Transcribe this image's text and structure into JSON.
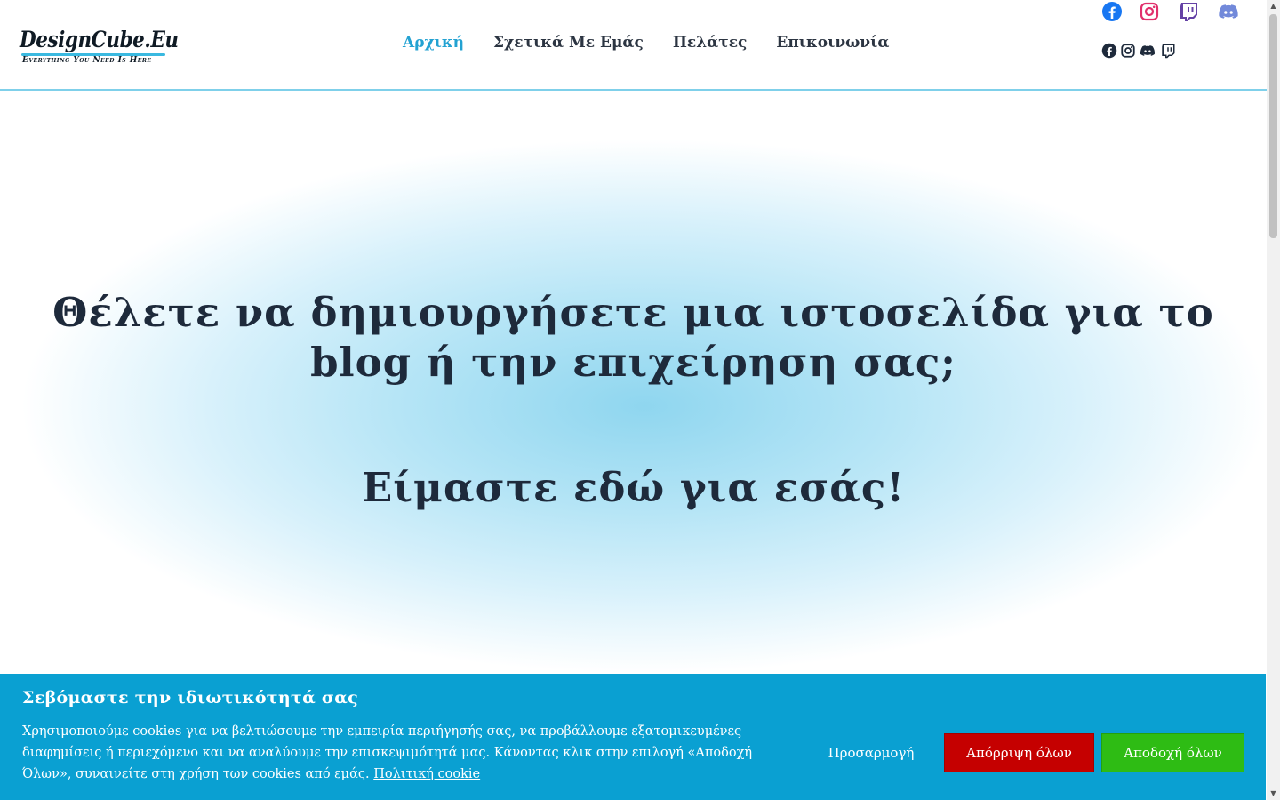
{
  "header": {
    "logo_main": "DesignCube.Eu",
    "logo_tagline": "Everything You Need Is Here",
    "nav": [
      {
        "label": "Αρχική",
        "active": true
      },
      {
        "label": "Σχετικά Με Εμάς",
        "active": false
      },
      {
        "label": "Πελάτες",
        "active": false
      },
      {
        "label": "Επικοινωνία",
        "active": false
      }
    ],
    "social_large": [
      {
        "name": "facebook-icon",
        "color": "#1877f2"
      },
      {
        "name": "instagram-icon",
        "color": "#e1306c"
      },
      {
        "name": "twitch-icon",
        "color": "#6441a5"
      },
      {
        "name": "discord-icon",
        "color": "#7289da"
      }
    ],
    "social_small": [
      {
        "name": "facebook-icon",
        "color": "#1e2a3b"
      },
      {
        "name": "instagram-icon",
        "color": "#1e2a3b"
      },
      {
        "name": "discord-icon",
        "color": "#1e2a3b"
      },
      {
        "name": "twitch-icon",
        "color": "#1e2a3b"
      }
    ]
  },
  "hero": {
    "title_line1": "Θέλετε να δημιουργήσετε μια ιστοσελίδα για το",
    "title_line2": "blog ή την επιχείρηση σας;",
    "subtitle": "Είμαστε εδώ για εσάς!"
  },
  "cookie": {
    "title": "Σεβόμαστε την ιδιωτικότητά σας",
    "text": "Χρησιμοποιούμε cookies για να βελτιώσουμε την εμπειρία περιήγησής σας, να προβάλλουμε εξατομικευμένες διαφημίσεις ή περιεχόμενο και να αναλύουμε την επισκεψιμότητά μας. Κάνοντας κλικ στην επιλογή «Αποδοχή Όλων», συναινείτε στη χρήση των cookies από εμάς.",
    "policy_link": "Πολιτική cookie",
    "customize_label": "Προσαρμογή",
    "reject_label": "Απόρριψη όλων",
    "accept_label": "Αποδοχή όλων",
    "bg_color": "#0aa0d2",
    "reject_color": "#c50000",
    "accept_color": "#2ebc14"
  },
  "colors": {
    "nav_active": "#23a2d2",
    "heading": "#1e2a3b"
  }
}
